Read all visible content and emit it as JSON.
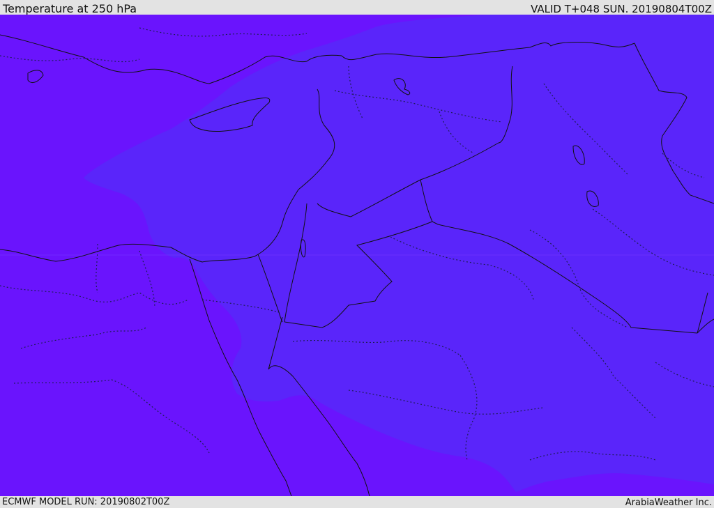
{
  "header": {
    "title": "Temperature at 250 hPa",
    "valid": "VALID T+048 SUN. 20190804T00Z"
  },
  "footer": {
    "model_run": "ECMWF MODEL RUN: 20190802T00Z",
    "credit": "ArabiaWeather Inc."
  },
  "map": {
    "field": "temperature",
    "level": "250 hPa",
    "colors": {
      "background_band": "#6a14fd",
      "mid_band": "#5a25fa",
      "coastline": "#111111",
      "border": "#111111",
      "province_border": "#1d1d55"
    },
    "color_bands": [
      "#6a14fd",
      "#5a25fa"
    ]
  }
}
